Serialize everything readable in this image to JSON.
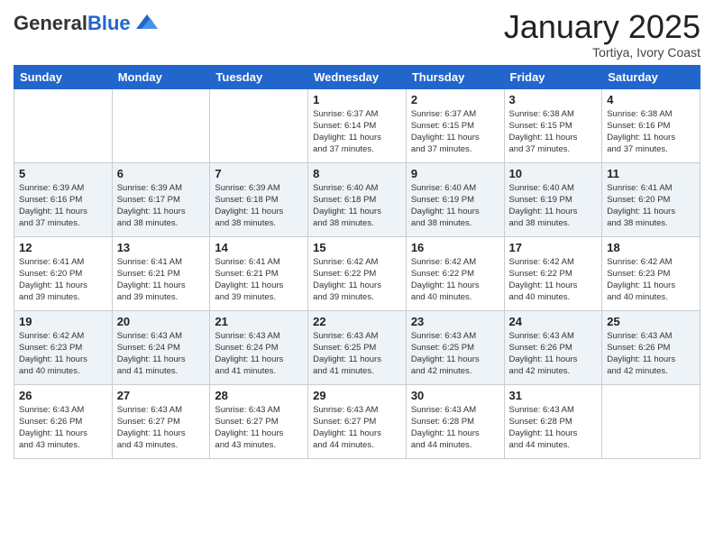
{
  "logo": {
    "general": "General",
    "blue": "Blue"
  },
  "header": {
    "month": "January 2025",
    "location": "Tortiya, Ivory Coast"
  },
  "weekdays": [
    "Sunday",
    "Monday",
    "Tuesday",
    "Wednesday",
    "Thursday",
    "Friday",
    "Saturday"
  ],
  "weeks": [
    [
      {
        "day": "",
        "info": ""
      },
      {
        "day": "",
        "info": ""
      },
      {
        "day": "",
        "info": ""
      },
      {
        "day": "1",
        "info": "Sunrise: 6:37 AM\nSunset: 6:14 PM\nDaylight: 11 hours\nand 37 minutes."
      },
      {
        "day": "2",
        "info": "Sunrise: 6:37 AM\nSunset: 6:15 PM\nDaylight: 11 hours\nand 37 minutes."
      },
      {
        "day": "3",
        "info": "Sunrise: 6:38 AM\nSunset: 6:15 PM\nDaylight: 11 hours\nand 37 minutes."
      },
      {
        "day": "4",
        "info": "Sunrise: 6:38 AM\nSunset: 6:16 PM\nDaylight: 11 hours\nand 37 minutes."
      }
    ],
    [
      {
        "day": "5",
        "info": "Sunrise: 6:39 AM\nSunset: 6:16 PM\nDaylight: 11 hours\nand 37 minutes."
      },
      {
        "day": "6",
        "info": "Sunrise: 6:39 AM\nSunset: 6:17 PM\nDaylight: 11 hours\nand 38 minutes."
      },
      {
        "day": "7",
        "info": "Sunrise: 6:39 AM\nSunset: 6:18 PM\nDaylight: 11 hours\nand 38 minutes."
      },
      {
        "day": "8",
        "info": "Sunrise: 6:40 AM\nSunset: 6:18 PM\nDaylight: 11 hours\nand 38 minutes."
      },
      {
        "day": "9",
        "info": "Sunrise: 6:40 AM\nSunset: 6:19 PM\nDaylight: 11 hours\nand 38 minutes."
      },
      {
        "day": "10",
        "info": "Sunrise: 6:40 AM\nSunset: 6:19 PM\nDaylight: 11 hours\nand 38 minutes."
      },
      {
        "day": "11",
        "info": "Sunrise: 6:41 AM\nSunset: 6:20 PM\nDaylight: 11 hours\nand 38 minutes."
      }
    ],
    [
      {
        "day": "12",
        "info": "Sunrise: 6:41 AM\nSunset: 6:20 PM\nDaylight: 11 hours\nand 39 minutes."
      },
      {
        "day": "13",
        "info": "Sunrise: 6:41 AM\nSunset: 6:21 PM\nDaylight: 11 hours\nand 39 minutes."
      },
      {
        "day": "14",
        "info": "Sunrise: 6:41 AM\nSunset: 6:21 PM\nDaylight: 11 hours\nand 39 minutes."
      },
      {
        "day": "15",
        "info": "Sunrise: 6:42 AM\nSunset: 6:22 PM\nDaylight: 11 hours\nand 39 minutes."
      },
      {
        "day": "16",
        "info": "Sunrise: 6:42 AM\nSunset: 6:22 PM\nDaylight: 11 hours\nand 40 minutes."
      },
      {
        "day": "17",
        "info": "Sunrise: 6:42 AM\nSunset: 6:22 PM\nDaylight: 11 hours\nand 40 minutes."
      },
      {
        "day": "18",
        "info": "Sunrise: 6:42 AM\nSunset: 6:23 PM\nDaylight: 11 hours\nand 40 minutes."
      }
    ],
    [
      {
        "day": "19",
        "info": "Sunrise: 6:42 AM\nSunset: 6:23 PM\nDaylight: 11 hours\nand 40 minutes."
      },
      {
        "day": "20",
        "info": "Sunrise: 6:43 AM\nSunset: 6:24 PM\nDaylight: 11 hours\nand 41 minutes."
      },
      {
        "day": "21",
        "info": "Sunrise: 6:43 AM\nSunset: 6:24 PM\nDaylight: 11 hours\nand 41 minutes."
      },
      {
        "day": "22",
        "info": "Sunrise: 6:43 AM\nSunset: 6:25 PM\nDaylight: 11 hours\nand 41 minutes."
      },
      {
        "day": "23",
        "info": "Sunrise: 6:43 AM\nSunset: 6:25 PM\nDaylight: 11 hours\nand 42 minutes."
      },
      {
        "day": "24",
        "info": "Sunrise: 6:43 AM\nSunset: 6:26 PM\nDaylight: 11 hours\nand 42 minutes."
      },
      {
        "day": "25",
        "info": "Sunrise: 6:43 AM\nSunset: 6:26 PM\nDaylight: 11 hours\nand 42 minutes."
      }
    ],
    [
      {
        "day": "26",
        "info": "Sunrise: 6:43 AM\nSunset: 6:26 PM\nDaylight: 11 hours\nand 43 minutes."
      },
      {
        "day": "27",
        "info": "Sunrise: 6:43 AM\nSunset: 6:27 PM\nDaylight: 11 hours\nand 43 minutes."
      },
      {
        "day": "28",
        "info": "Sunrise: 6:43 AM\nSunset: 6:27 PM\nDaylight: 11 hours\nand 43 minutes."
      },
      {
        "day": "29",
        "info": "Sunrise: 6:43 AM\nSunset: 6:27 PM\nDaylight: 11 hours\nand 44 minutes."
      },
      {
        "day": "30",
        "info": "Sunrise: 6:43 AM\nSunset: 6:28 PM\nDaylight: 11 hours\nand 44 minutes."
      },
      {
        "day": "31",
        "info": "Sunrise: 6:43 AM\nSunset: 6:28 PM\nDaylight: 11 hours\nand 44 minutes."
      },
      {
        "day": "",
        "info": ""
      }
    ]
  ]
}
